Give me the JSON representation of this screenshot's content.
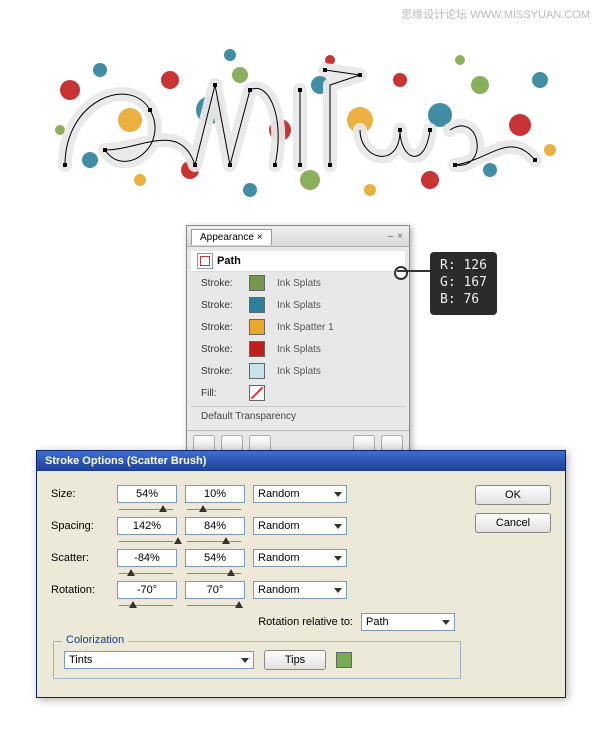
{
  "watermark": "思缘设计论坛  WWW.MISSYUAN.COM",
  "appearance_panel": {
    "tab": "Appearance",
    "item": "Path",
    "strokes": [
      {
        "label": "Stroke:",
        "color": "#75964c",
        "brush": "Ink Splats"
      },
      {
        "label": "Stroke:",
        "color": "#2d819b",
        "brush": "Ink Splats"
      },
      {
        "label": "Stroke:",
        "color": "#e8a92c",
        "brush": "Ink Spatter 1"
      },
      {
        "label": "Stroke:",
        "color": "#c31e1e",
        "brush": "Ink Splats"
      },
      {
        "label": "Stroke:",
        "color": "#c7e3ea",
        "brush": "Ink Splats"
      }
    ],
    "fill_label": "Fill:",
    "default_transparency": "Default Transparency"
  },
  "rgb": {
    "r": "R: 126",
    "g": "G: 167",
    "b": "B:  76"
  },
  "dialog": {
    "title": "Stroke Options (Scatter Brush)",
    "ok": "OK",
    "cancel": "Cancel",
    "rows": [
      {
        "label": "Size:",
        "a": "54%",
        "b": "10%",
        "mode": "Random"
      },
      {
        "label": "Spacing:",
        "a": "142%",
        "b": "84%",
        "mode": "Random"
      },
      {
        "label": "Scatter:",
        "a": "-84%",
        "b": "54%",
        "mode": "Random"
      },
      {
        "label": "Rotation:",
        "a": "-70°",
        "b": "70°",
        "mode": "Random"
      }
    ],
    "rotation_rel": {
      "label": "Rotation relative to:",
      "value": "Path"
    },
    "colorization": {
      "legend": "Colorization",
      "value": "Tints",
      "tips": "Tips"
    }
  }
}
